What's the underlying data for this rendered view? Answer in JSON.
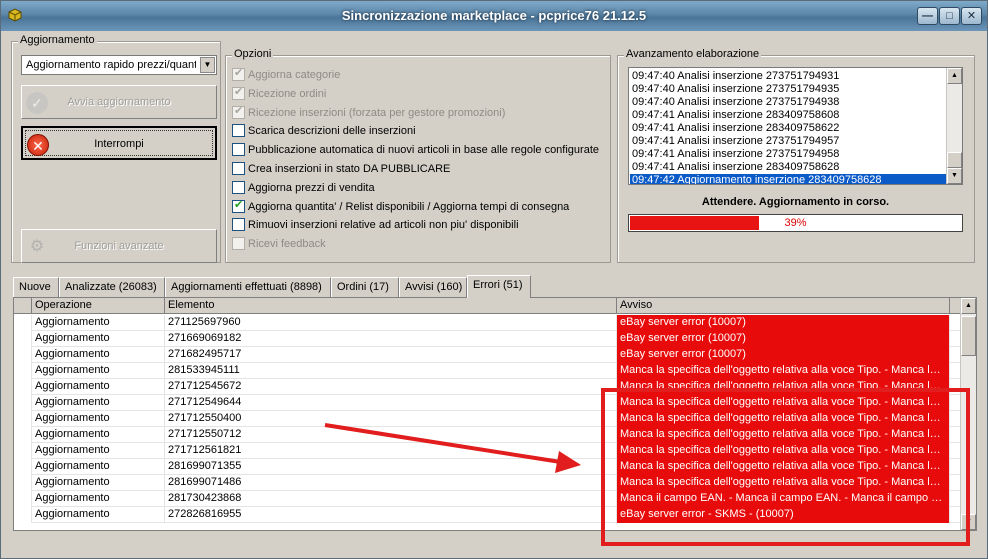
{
  "window": {
    "title": "Sincronizzazione marketplace - pcprice76 21.12.5"
  },
  "group_aggiornamento": {
    "label": "Aggiornamento",
    "mode_selected": "Aggiornamento rapido prezzi/quantit",
    "start_label": "Avvia aggiornamento",
    "stop_label": "Interrompi",
    "advanced_label": "Funzioni avanzate"
  },
  "group_opzioni": {
    "label": "Opzioni",
    "options": [
      {
        "label": "Aggiorna categorie",
        "checked": true,
        "enabled": false
      },
      {
        "label": "Ricezione ordini",
        "checked": true,
        "enabled": false
      },
      {
        "label": "Ricezione inserzioni (forzata per gestore promozioni)",
        "checked": true,
        "enabled": false
      },
      {
        "label": "Scarica descrizioni delle inserzioni",
        "checked": false,
        "enabled": true
      },
      {
        "label": "Pubblicazione automatica di nuovi articoli in base alle regole configurate",
        "checked": false,
        "enabled": true
      },
      {
        "label": "Crea inserzioni in stato DA PUBBLICARE",
        "checked": false,
        "enabled": true
      },
      {
        "label": "Aggiorna prezzi di vendita",
        "checked": false,
        "enabled": true
      },
      {
        "label": "Aggiorna quantita' / Relist disponibili / Aggiorna tempi di consegna",
        "checked": true,
        "enabled": true
      },
      {
        "label": "Rimuovi inserzioni relative ad articoli non piu' disponibili",
        "checked": false,
        "enabled": true
      },
      {
        "label": "Ricevi feedback",
        "checked": false,
        "enabled": false
      }
    ]
  },
  "group_avanzamento": {
    "label": "Avanzamento elaborazione",
    "log": [
      "09:47:40 Analisi inserzione 273751794931",
      "09:47:40 Analisi inserzione 273751794935",
      "09:47:40 Analisi inserzione 273751794938",
      "09:47:41 Analisi inserzione 283409758608",
      "09:47:41 Analisi inserzione 283409758622",
      "09:47:41 Analisi inserzione 273751794957",
      "09:47:41 Analisi inserzione 273751794958",
      "09:47:41 Analisi inserzione 283409758628",
      "09:47:42 Aggiornamento inserzione 283409758628"
    ],
    "status_text": "Attendere. Aggiornamento in corso.",
    "progress_text": "39%",
    "progress_value": 0.39
  },
  "tabs": [
    "Nuove",
    "Analizzate (26083)",
    "Aggiornamenti effettuati (8898)",
    "Ordini (17)",
    "Avvisi (160)",
    "Errori (51)"
  ],
  "grid": {
    "columns": [
      "Operazione",
      "Elemento",
      "Avviso"
    ],
    "rows": [
      [
        "Aggiornamento",
        "271125697960",
        "eBay server error (10007)"
      ],
      [
        "Aggiornamento",
        "271669069182",
        "eBay server error (10007)"
      ],
      [
        "Aggiornamento",
        "271682495717",
        "eBay server error (10007)"
      ],
      [
        "Aggiornamento",
        "281533945111",
        "Manca la specifica dell'oggetto relativa alla voce Tipo. - Manca la specifica dell'oggetto relativa alla voce Tipo."
      ],
      [
        "Aggiornamento",
        "271712545672",
        "Manca la specifica dell'oggetto relativa alla voce Tipo. - Manca la specifica dell'oggetto relativa alla voce Tipo."
      ],
      [
        "Aggiornamento",
        "271712549644",
        "Manca la specifica dell'oggetto relativa alla voce Tipo. - Manca la specifica dell'oggetto relativa alla voce Tipo."
      ],
      [
        "Aggiornamento",
        "271712550400",
        "Manca la specifica dell'oggetto relativa alla voce Tipo. - Manca la specifica dell'oggetto relativa alla voce Tipo."
      ],
      [
        "Aggiornamento",
        "271712550712",
        "Manca la specifica dell'oggetto relativa alla voce Tipo. - Manca la specifica dell'oggetto relativa alla voce Tipo."
      ],
      [
        "Aggiornamento",
        "271712561821",
        "Manca la specifica dell'oggetto relativa alla voce Tipo. - Manca la specifica dell'oggetto relativa alla voce Tipo."
      ],
      [
        "Aggiornamento",
        "281699071355",
        "Manca la specifica dell'oggetto relativa alla voce Tipo. - Manca la specifica dell'oggetto relativa alla voce Tipo."
      ],
      [
        "Aggiornamento",
        "281699071486",
        "Manca la specifica dell'oggetto relativa alla voce Tipo. - Manca la specifica dell'oggetto relativa alla voce Tipo."
      ],
      [
        "Aggiornamento",
        "281730423868",
        "Manca il campo EAN. - Manca il campo EAN. - Manca il campo EAN."
      ],
      [
        "Aggiornamento",
        "272826816955",
        "eBay server error - SKMS - (10007)"
      ]
    ]
  },
  "colors": {
    "error_cell": "#e80b0b",
    "progress": "#e81313",
    "annotation": "#e11d1d",
    "selection": "#0a5ac8"
  },
  "icons": [
    "app-icon",
    "minimize-icon",
    "maximize-icon",
    "close-icon",
    "check-icon",
    "stop-icon",
    "gear-icon",
    "chevron-down-icon"
  ]
}
